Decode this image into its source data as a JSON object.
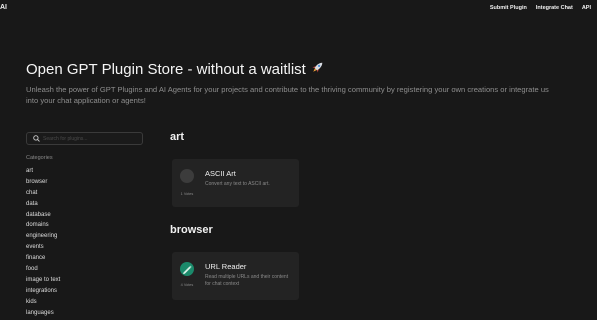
{
  "header": {
    "logo": "AI",
    "nav": [
      "Submit Plugin",
      "Integrate Chat",
      "API"
    ]
  },
  "hero": {
    "title": "Open GPT Plugin Store - without a waitlist",
    "subtitle": "Unleash the power of GPT Plugins and AI Agents for your projects and contribute to the thriving community by registering your own creations or integrate us into your chat application or agents!"
  },
  "sidebar": {
    "search_placeholder": "Search for plugins...",
    "categories_label": "Categories",
    "categories": [
      "art",
      "browser",
      "chat",
      "data",
      "database",
      "domains",
      "engineering",
      "events",
      "finance",
      "food",
      "image to text",
      "integrations",
      "kids",
      "languages"
    ]
  },
  "sections": [
    {
      "title": "art",
      "plugin": {
        "name": "ASCII Art",
        "description": "Convert any text to ASCII art.",
        "votes": "1 Votes"
      }
    },
    {
      "title": "browser",
      "plugin": {
        "name": "URL Reader",
        "description": "Read multiple URLs and their content for chat context",
        "votes": "4 Votes"
      }
    }
  ],
  "colors": {
    "background": "#181818",
    "card": "#232323",
    "accent": "#1b8a6b"
  },
  "icons": {
    "search": "search-icon",
    "rocket": "rocket-icon",
    "plugin_logo": "pencil-logo-icon"
  }
}
